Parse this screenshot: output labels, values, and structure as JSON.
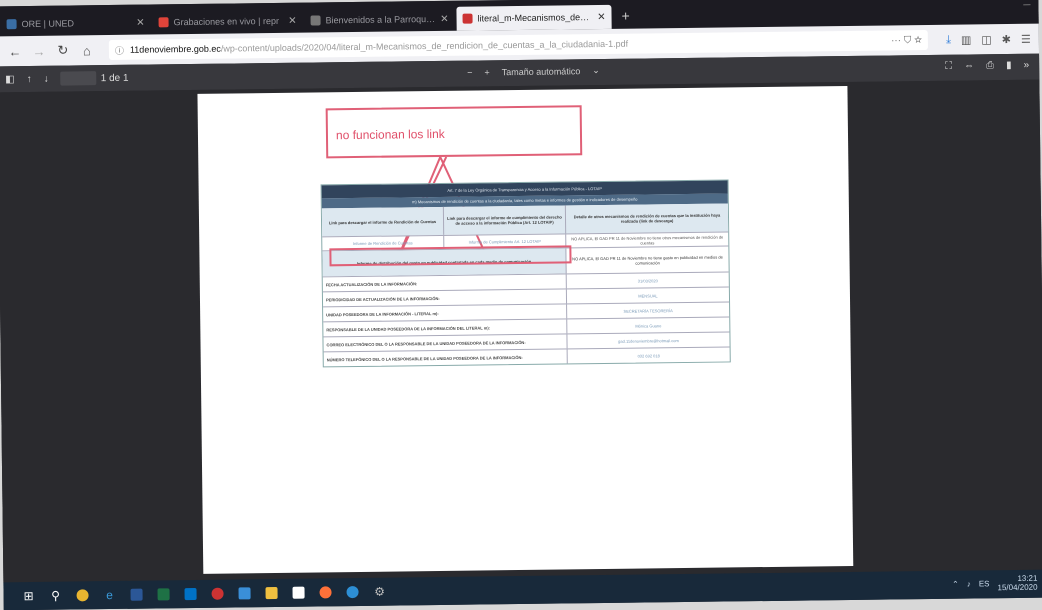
{
  "tabs": [
    {
      "title": "ORE | UNED",
      "active": false
    },
    {
      "title": "Grabaciones en vivo | repr",
      "active": false
    },
    {
      "title": "Bienvenidos a la Parroquia de",
      "active": false
    },
    {
      "title": "literal_m-Mecanismos_de_rendic",
      "active": true
    }
  ],
  "nav": {
    "host": "11denoviembre.gob.ec",
    "path": "/wp-content/uploads/2020/04/literal_m-Mecanismos_de_rendicion_de_cuentas_a_la_ciudadania-1.pdf",
    "meta": "··· ⛉ ☆"
  },
  "pdf": {
    "page_indicator": "1 de 1",
    "zoom_label": "Tamaño automático"
  },
  "annotation": {
    "text": "no funcionan los link"
  },
  "document": {
    "title": "Art. 7 de la Ley Orgánica de Transparencia y Acceso a la Información Pública - LOTAIP",
    "subtitle": "m) Mecanismos de rendición de cuentas a la ciudadanía, tales como metas e informes de gestión e indicadores de desempeño",
    "headers": [
      "Link para descargar el informe de Rendición de Cuentas",
      "Link para descargar el informe de cumplimiento del derecho de acceso a la información Pública (Art. 12 LOTAIP)",
      "Detalle de otros mecanismos de rendición de cuentas que la institución haya realizado (link de descarga)"
    ],
    "links": [
      "Informe de Rendición de Cuentas",
      "Informe de Cumplimiento Art. 12 LOTAIP",
      "NO APLICA, El GAD PR 11 de Noviembre no tiene otros mecanismos de rendición de cuentas"
    ],
    "publicity": {
      "label": "Informe de distribución del gasto en publicidad contratada en cada medio de comunicación",
      "value": "NO APLICA, El GAD PR 11 de Noviembre no tiene gasto en publicidad en medios de comunicación"
    },
    "info_rows": [
      {
        "label": "FECHA ACTUALIZACIÓN DE LA INFORMACIÓN:",
        "value": "31/03/2020"
      },
      {
        "label": "PERIODICIDAD DE ACTUALIZACIÓN DE LA INFORMACIÓN:",
        "value": "MENSUAL"
      },
      {
        "label": "UNIDAD POSEEDORA DE LA INFORMACIÓN - LITERAL m):",
        "value": "SECRETARÍA TESORERÍA"
      },
      {
        "label": "RESPONSABLE DE LA UNIDAD POSEEDORA DE LA INFORMACIÓN DEL LITERAL m):",
        "value": "Mónica Guano"
      },
      {
        "label": "CORREO ELECTRÓNICO DEL O LA RESPONSABLE DE LA UNIDAD POSEEDORA DE LA INFORMACIÓN:",
        "value": "gad.11denoviembre@hotmail.com"
      },
      {
        "label": "NÚMERO TELEFÓNICO DEL O LA RESPONSABLE DE LA UNIDAD POSEEDORA DE LA INFORMACIÓN:",
        "value": "032 692 018"
      }
    ]
  },
  "taskbar": {
    "clock_time": "13:21",
    "clock_date": "15/04/2020",
    "lang": "ES"
  }
}
